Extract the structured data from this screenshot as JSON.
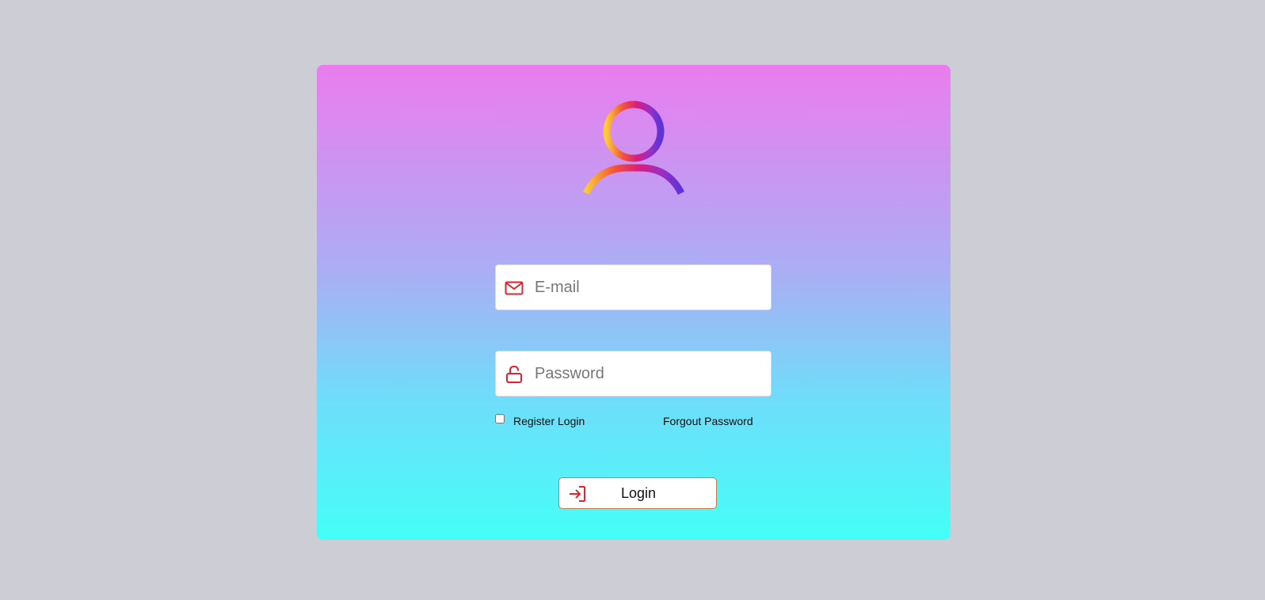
{
  "login_form": {
    "email": {
      "placeholder": "E-mail",
      "value": ""
    },
    "password": {
      "placeholder": "Password",
      "value": ""
    },
    "remember_label": "Register Login",
    "remember_checked": false,
    "forgot_label": "Forgout Password",
    "login_label": "Login"
  },
  "icons": {
    "avatar": "user-avatar-icon",
    "email": "envelope-icon",
    "password": "unlock-icon",
    "login": "sign-in-icon"
  },
  "colors": {
    "background": "#cdcdd6",
    "card_gradient_top": "#eb7cee",
    "card_gradient_bottom": "#44fff8",
    "icon_red": "#e0242c",
    "button_border": "#c57a4a"
  }
}
